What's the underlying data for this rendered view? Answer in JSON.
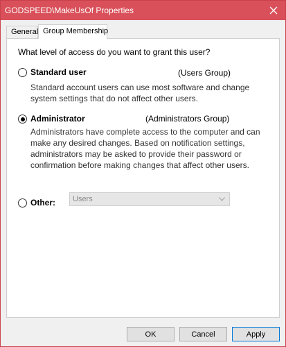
{
  "window": {
    "title": "GODSPEED\\MakeUsOf Properties",
    "accent_color": "#d9505a"
  },
  "tabs": [
    {
      "label": "General",
      "active": false
    },
    {
      "label": "Group Membership",
      "active": true
    }
  ],
  "prompt": "What level of access do you want to grant this user?",
  "options": {
    "standard": {
      "label": "Standard user",
      "group": "(Users Group)",
      "description": "Standard account users can use most software and change system settings that do not affect other users.",
      "selected": false
    },
    "administrator": {
      "label": "Administrator",
      "group": "(Administrators Group)",
      "description": "Administrators have complete access to the computer and can make any desired changes. Based on notification settings, administrators may be asked to provide their password or confirmation before making changes that affect other users.",
      "selected": true
    },
    "other": {
      "label": "Other:",
      "selected": false,
      "select_value": "Users"
    }
  },
  "buttons": {
    "ok": "OK",
    "cancel": "Cancel",
    "apply": "Apply"
  }
}
